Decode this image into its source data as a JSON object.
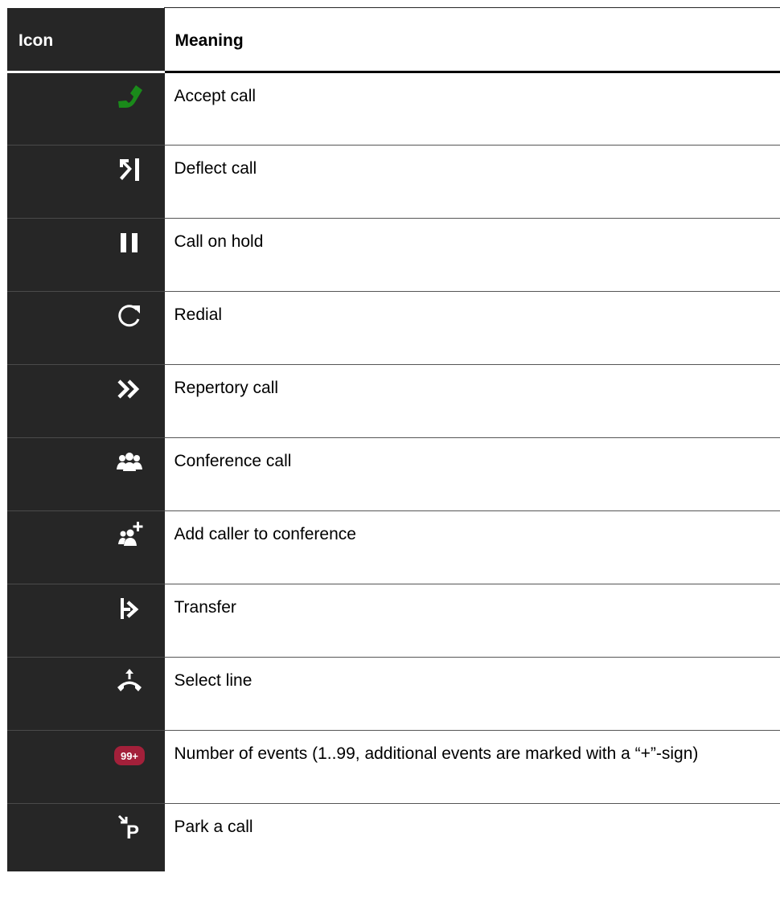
{
  "table": {
    "header_icon": "Icon",
    "header_meaning": "Meaning",
    "rows": [
      {
        "icon": "accept-call-icon",
        "meaning": "Accept call"
      },
      {
        "icon": "deflect-call-icon",
        "meaning": "Deflect call"
      },
      {
        "icon": "call-on-hold-icon",
        "meaning": "Call on hold"
      },
      {
        "icon": "redial-icon",
        "meaning": "Redial"
      },
      {
        "icon": "repertory-call-icon",
        "meaning": "Repertory call"
      },
      {
        "icon": "conference-call-icon",
        "meaning": "Conference call"
      },
      {
        "icon": "add-caller-icon",
        "meaning": "Add caller to conference"
      },
      {
        "icon": "transfer-icon",
        "meaning": "Transfer"
      },
      {
        "icon": "select-line-icon",
        "meaning": "Select line"
      },
      {
        "icon": "event-count-badge-icon",
        "meaning": "Number of events (1..99, additional events are marked with a “+”-sign)",
        "badge_text": "99+"
      },
      {
        "icon": "park-call-icon",
        "meaning": "Park a call",
        "icon_letter": "P"
      }
    ]
  },
  "colors": {
    "icon_column_bg": "#262626",
    "accept_green": "#1a8a1a",
    "badge_red": "#a3203a",
    "icon_white": "#ffffff"
  }
}
